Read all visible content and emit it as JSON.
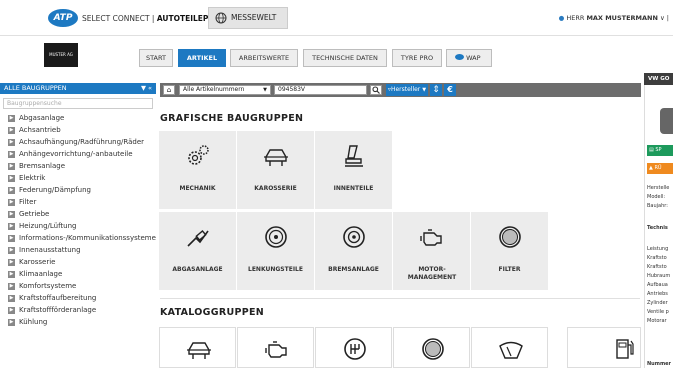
{
  "header": {
    "logo": "ATP",
    "brand_prefix": "SELECT CONNECT |",
    "brand_name": "AUTOTEILEPILOT",
    "messewelt": "MESSEWELT",
    "user_prefix": "HERR",
    "user_name": "MAX MUSTERMANN",
    "user_suffix": "∨ |"
  },
  "dealer_logo": "MUSTER AG",
  "tabs": [
    {
      "label": "START"
    },
    {
      "label": "ARTIKEL",
      "active": true
    },
    {
      "label": "ARBEITSWERTE"
    },
    {
      "label": "TECHNISCHE DATEN"
    },
    {
      "label": "TYRE PRO"
    },
    {
      "label": "WAP"
    }
  ],
  "sidebar": {
    "title": "ALLE BAUGRUPPEN",
    "search_placeholder": "Baugruppensuche",
    "items": [
      "Abgasanlage",
      "Achsantrieb",
      "Achsaufhängung/Radführung/Räder",
      "Anhängevorrichtung/-anbauteile",
      "Bremsanlage",
      "Elektrik",
      "Federung/Dämpfung",
      "Filter",
      "Getriebe",
      "Heizung/Lüftung",
      "Informations-/Kommunikationssysteme",
      "Innenausstattung",
      "Karosserie",
      "Klimaanlage",
      "Komfortsysteme",
      "Kraftstoffaufbereitung",
      "Kraftstoffförderanlage",
      "Kühlung"
    ]
  },
  "toolbar": {
    "select_value": "Alle Artikelnummern",
    "search_value": "094583V",
    "filter_label": "Hersteller",
    "accent": "#1d79c2"
  },
  "main": {
    "grafische_title": "GRAFISCHE BAUGRUPPEN",
    "tiles": [
      "MECHANIK",
      "KAROSSERIE",
      "INNENTEILE",
      "ABGASANLAGE",
      "LENKUNGSTEILE",
      "BREMSANLAGE",
      "MOTOR-MANAGEMENT",
      "FILTER"
    ],
    "katalog_title": "KATALOGGRUPPEN"
  },
  "right_panel": {
    "title": "VW GO",
    "btn1": "SP",
    "btn2": "RÜ",
    "lines1": [
      "Herstelle",
      "Modell:",
      "Baujahr:"
    ],
    "heading": "Technis",
    "lines2": [
      "Leistung",
      "Kraftsto",
      "Kraftsto",
      "Hubraum",
      "Aufbaua",
      "Antriebs",
      "Zylinder",
      "Ventile p",
      "Motorar"
    ],
    "footer": "Nummer"
  }
}
